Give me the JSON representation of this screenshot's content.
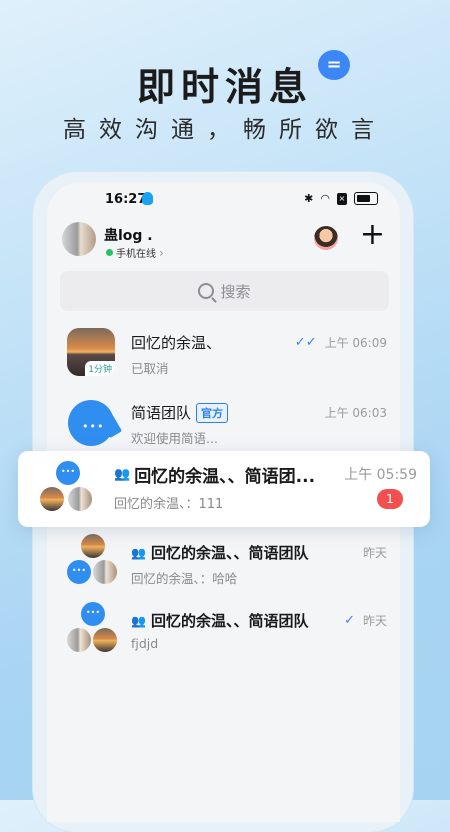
{
  "hero": {
    "title": "即时消息",
    "bubble": "=",
    "subtitle": "高效沟通，畅所欲言"
  },
  "status_bar": {
    "time": "16:27",
    "icons": [
      "bluetooth-icon",
      "wifi-icon",
      "sim-icon",
      "battery-icon"
    ]
  },
  "header": {
    "nickname": "蛊log .",
    "status": "手机在线",
    "chevron": "›",
    "plus": "+"
  },
  "search": {
    "placeholder": "搜索"
  },
  "conversations": [
    {
      "name": "回忆的余温、",
      "preview": "已取消",
      "time": "上午 06:09",
      "read_check": "✓✓",
      "avatar_tag": "1分钟"
    },
    {
      "name": "简语团队",
      "badge": "官方",
      "preview": "欢迎使用简语...",
      "time": "上午 06:03"
    },
    {
      "name": "回忆的余温、、简语团...",
      "preview": "回忆的余温、：111",
      "time": "上午 05:59",
      "unread": "1"
    },
    {
      "name": "回忆的余温、、简语团队",
      "preview": "回忆的余温、：哈哈",
      "time": "昨天"
    },
    {
      "name": "回忆的余温、、简语团队",
      "preview": "fjdjd",
      "time": "昨天",
      "read_check": "✓"
    }
  ],
  "colors": {
    "accent": "#3d86f5",
    "unread": "#f25050",
    "online": "#22c55e",
    "official": "#2f7ef0"
  }
}
